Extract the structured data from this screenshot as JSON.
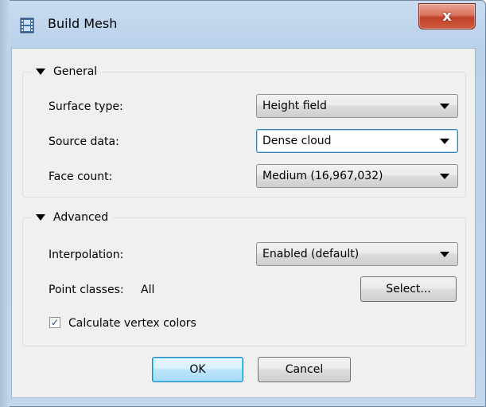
{
  "window": {
    "title": "Build Mesh",
    "close_label": "x",
    "icon": "film-strip-icon"
  },
  "general": {
    "section_label": "General",
    "surface_type": {
      "label": "Surface type:",
      "value": "Height field"
    },
    "source_data": {
      "label": "Source data:",
      "value": "Dense cloud"
    },
    "face_count": {
      "label": "Face count:",
      "value": "Medium (16,967,032)"
    }
  },
  "advanced": {
    "section_label": "Advanced",
    "interpolation": {
      "label": "Interpolation:",
      "value": "Enabled (default)"
    },
    "point_classes": {
      "label": "Point classes:",
      "value": "All"
    },
    "select_button": "Select...",
    "vertex_colors": {
      "label": "Calculate vertex colors",
      "checked": true
    }
  },
  "buttons": {
    "ok": "OK",
    "cancel": "Cancel"
  }
}
